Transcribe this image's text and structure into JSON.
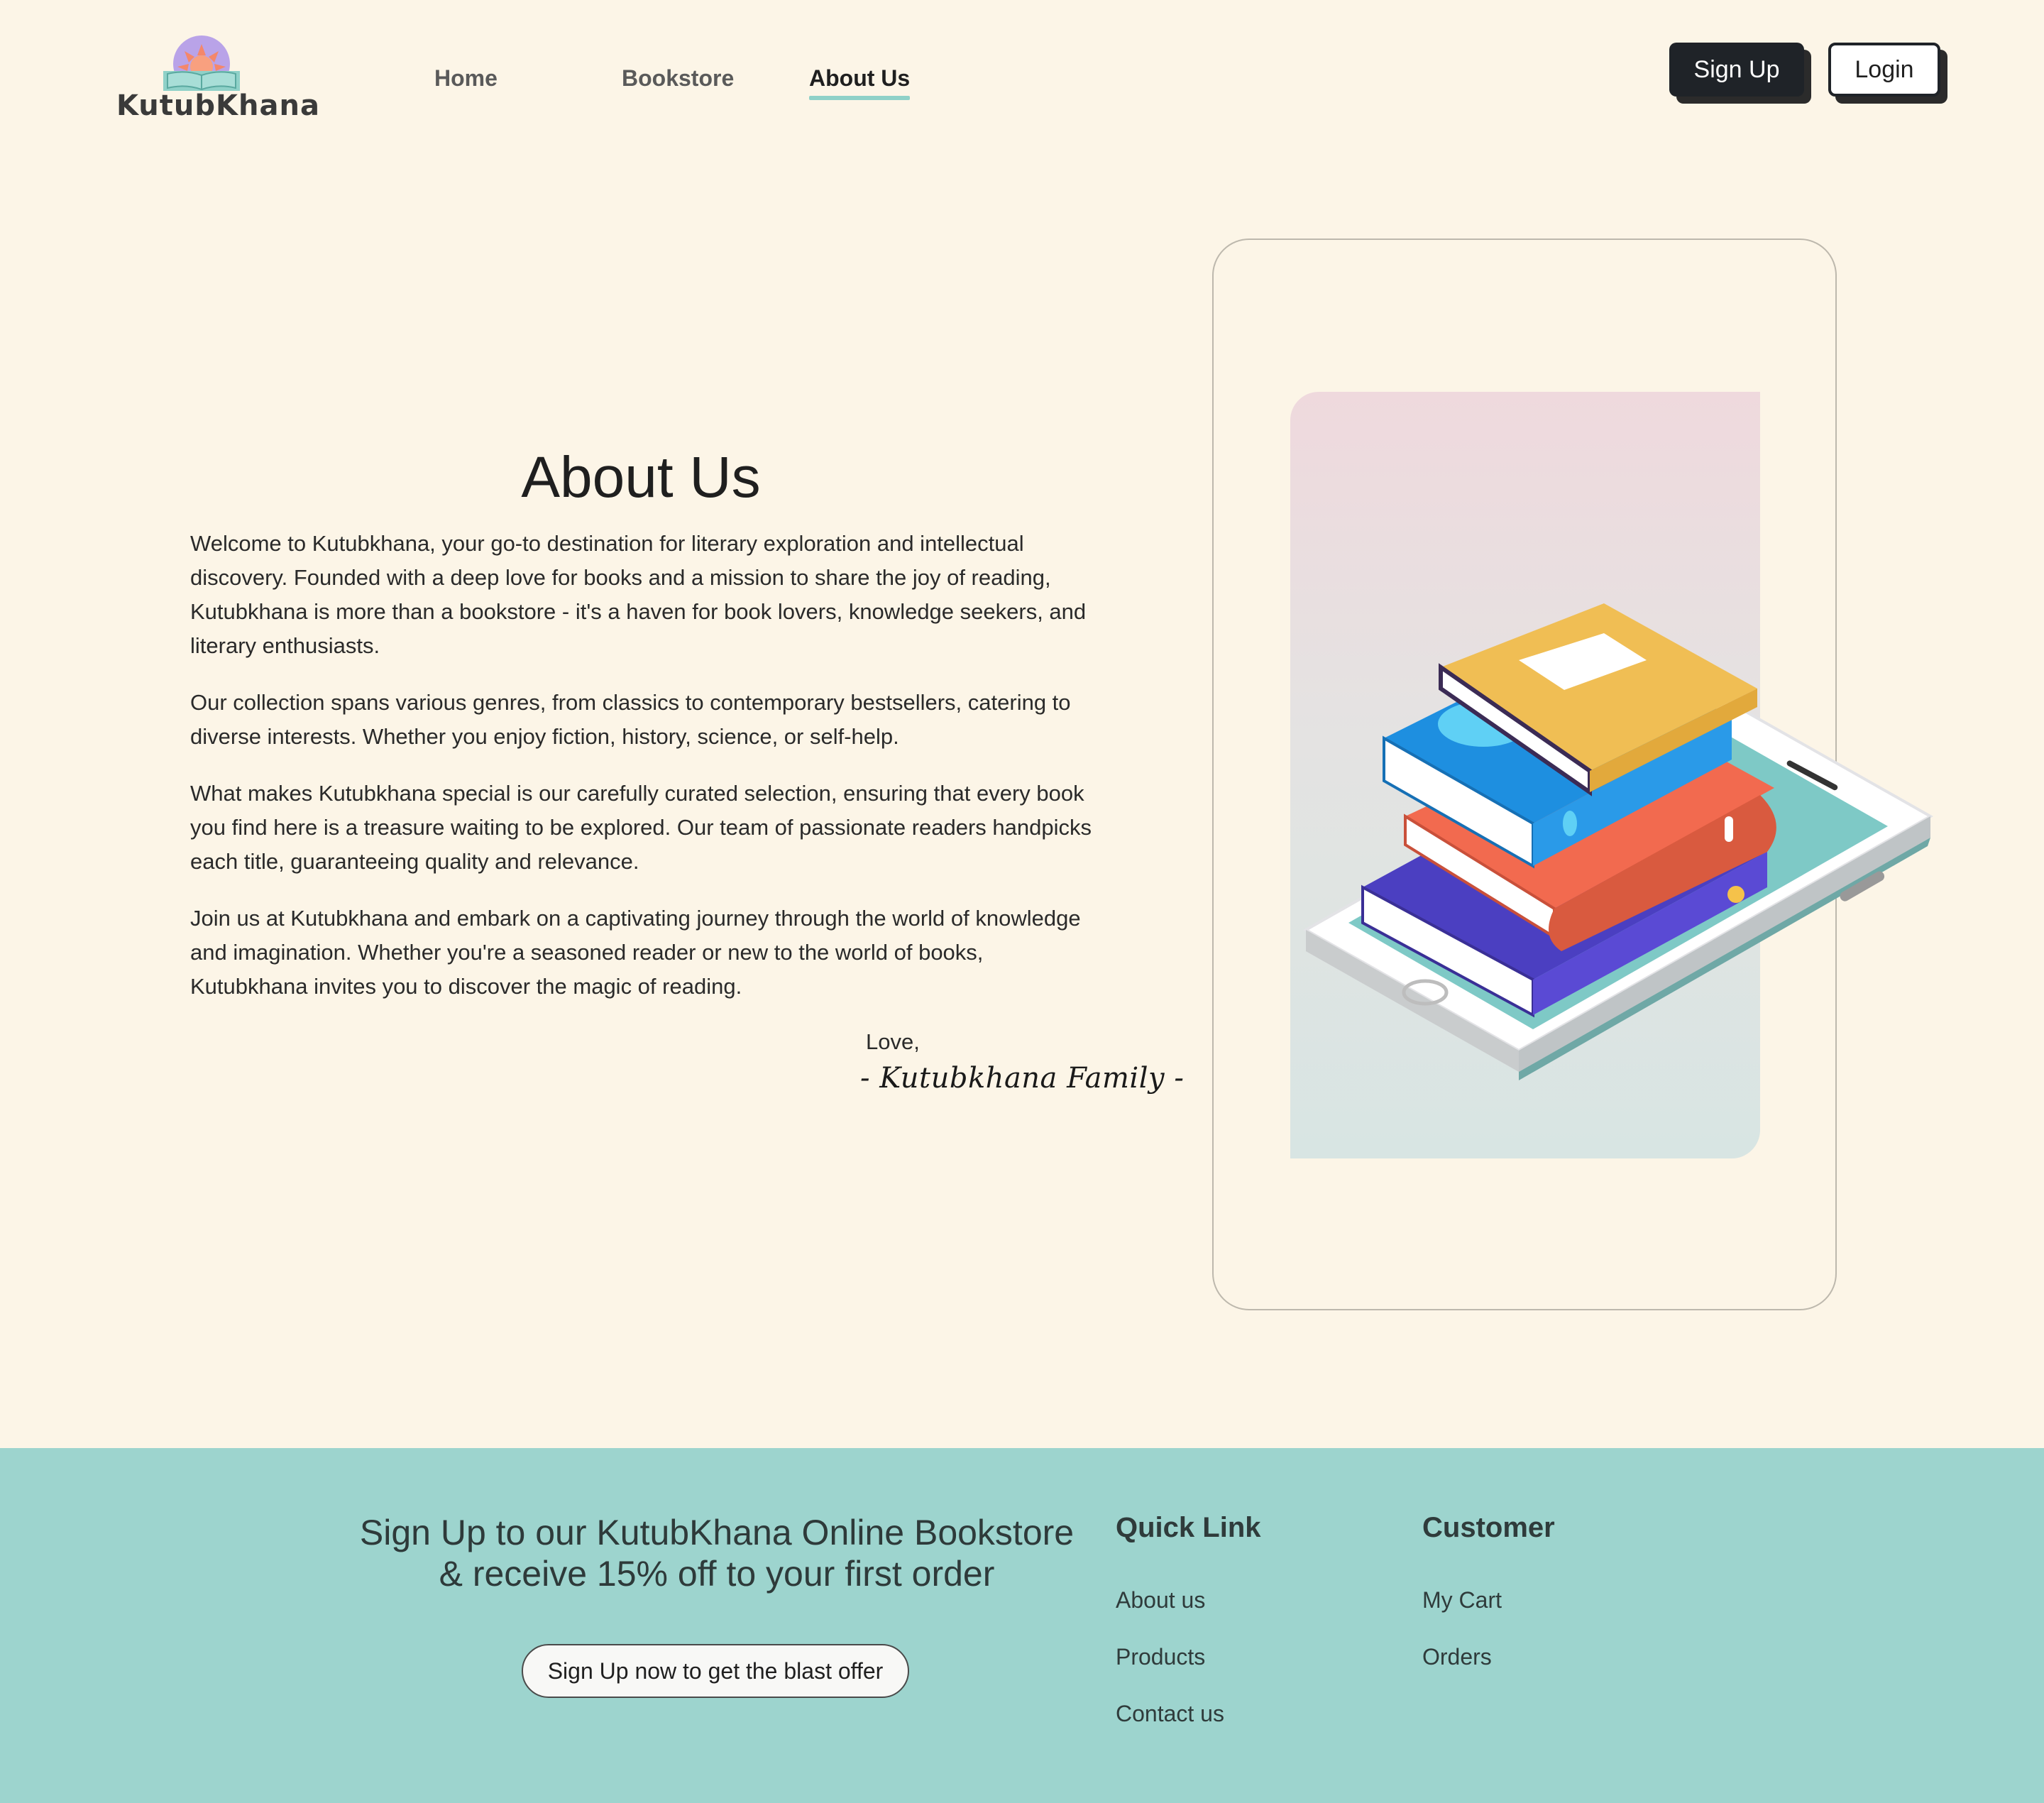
{
  "header": {
    "logo_text": "KutubKhana",
    "nav": [
      {
        "label": "Home",
        "active": false
      },
      {
        "label": "Bookstore",
        "active": false
      },
      {
        "label": "About Us",
        "active": true
      }
    ],
    "signup_label": "Sign Up",
    "login_label": "Login"
  },
  "main": {
    "title": "About Us",
    "paragraphs": [
      "Welcome to Kutubkhana, your go-to destination for literary exploration and intellectual discovery. Founded with a deep love for books and a mission to share the joy of reading, Kutubkhana is more than a bookstore - it's a haven for book lovers, knowledge seekers, and literary enthusiasts.",
      "Our collection spans various genres, from classics to contemporary bestsellers, catering to diverse interests. Whether you enjoy fiction, history, science, or self-help.",
      "What makes Kutubkhana special is our carefully curated selection, ensuring that every book you find here is a treasure waiting to be explored. Our team of passionate readers handpicks each title, guaranteeing quality and relevance.",
      "Join us at Kutubkhana and embark on a captivating journey through the world of knowledge and imagination. Whether you're a seasoned reader or new to the world of books, Kutubkhana invites you to discover the magic of reading."
    ],
    "closing": "Love,",
    "signature": "- Kutubkhana Family -"
  },
  "footer": {
    "promo_line1": "Sign Up to our KutubKhana Online Bookstore",
    "promo_line2": "& receive 15% off to your first order",
    "promo_button": "Sign Up now to get the blast offer",
    "quick_link": {
      "heading": "Quick Link",
      "links": [
        "About us",
        "Products",
        "Contact us"
      ]
    },
    "customer": {
      "heading": "Customer",
      "links": [
        "My Cart",
        "Orders"
      ]
    }
  },
  "colors": {
    "page_bg": "#fcf5e7",
    "footer_bg": "#9dd4ce",
    "active_underline": "#8fd1c8",
    "button_dark": "#1f2328"
  }
}
